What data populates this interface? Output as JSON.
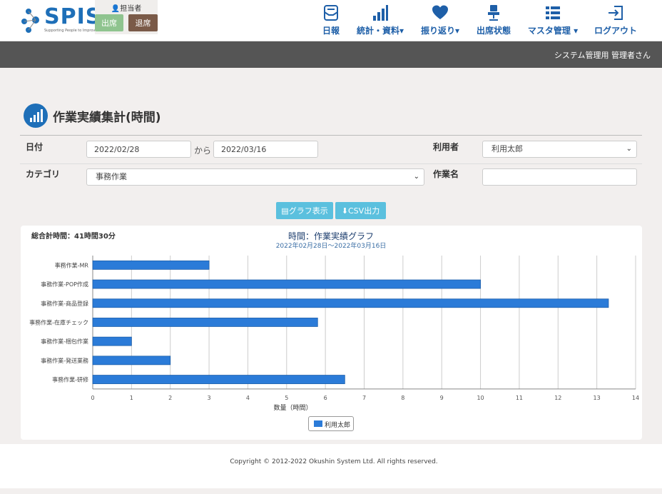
{
  "header": {
    "logo_text": "SPIS",
    "logo_tagline": "Supporting People to Improve Stability",
    "attendance": {
      "label": "担当者",
      "in_label": "出席",
      "out_label": "退席"
    },
    "nav": [
      {
        "label": "日報",
        "icon": "daily-report-icon"
      },
      {
        "label": "統計・資料▾",
        "icon": "bar-chart-icon"
      },
      {
        "label": "振り返り▾",
        "icon": "heart-icon"
      },
      {
        "label": "出席状態",
        "icon": "chair-icon"
      },
      {
        "label": "マスタ管理 ▾",
        "icon": "list-icon"
      },
      {
        "label": "ログアウト",
        "icon": "logout-icon"
      }
    ],
    "user": "システム管理用 管理者さん"
  },
  "page": {
    "title": "作業実績集計(時間)"
  },
  "form": {
    "date_label": "日付",
    "date_from": "2022/02/28",
    "from_text": "から",
    "date_to": "2022/03/16",
    "user_label": "利用者",
    "user_value": "利用太郎",
    "category_label": "カテゴリ",
    "category_value": "事務作業",
    "work_label": "作業名",
    "work_value": "",
    "graph_button": "グラフ表示",
    "csv_button": "CSV出力"
  },
  "chart_panel": {
    "total": "総合計時間：41時間30分"
  },
  "chart_data": {
    "type": "bar",
    "orientation": "horizontal",
    "title": "時間：作業実績グラフ",
    "subtitle": "2022年02月28日～2022年03月16日",
    "xlabel": "数量（時間）",
    "ylabel": "",
    "xlim": [
      0,
      14
    ],
    "xticks": [
      0,
      1,
      2,
      3,
      4,
      5,
      6,
      7,
      8,
      9,
      10,
      11,
      12,
      13,
      14
    ],
    "grid": true,
    "legend": "bottom-center",
    "color": "#2b7bd8",
    "categories": [
      "事務作業-MR",
      "事務作業-POP作成",
      "事務作業-商品登録",
      "事務作業-在庫チェック",
      "事務作業-梱包作業",
      "事務作業-発送業務",
      "事務作業-研修"
    ],
    "series": [
      {
        "name": "利用太郎",
        "values": [
          3,
          10,
          13.3,
          5.8,
          1,
          2,
          6.5
        ]
      }
    ]
  },
  "footer": {
    "copyright": "Copyright © 2012-2022 Okushin System Ltd. All rights reserved."
  }
}
